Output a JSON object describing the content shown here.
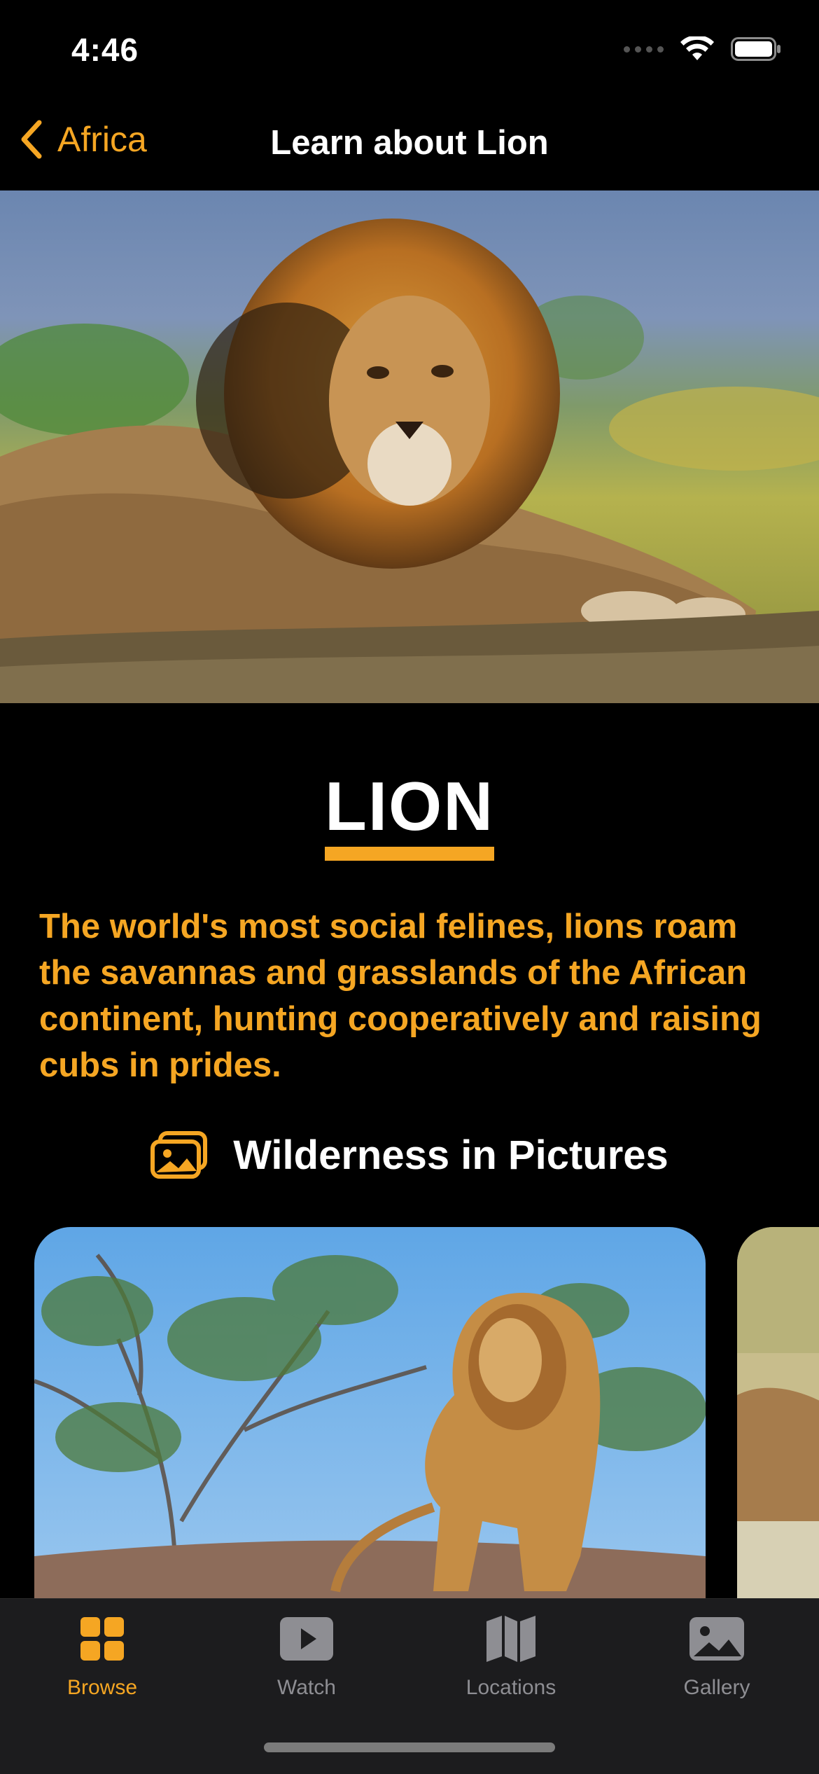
{
  "status_bar": {
    "time": "4:46"
  },
  "nav": {
    "back_label": "Africa",
    "title": "Learn about Lion"
  },
  "hero": {
    "image": "lion-lying-on-savanna"
  },
  "content": {
    "animal_name": "LION",
    "description": "The world's most social felines, lions roam the savannas and grasslands of the African continent, hunting cooperatively and raising cubs in prides.",
    "section_title": "Wilderness in Pictures",
    "section_icon": "photo-stack-icon"
  },
  "gallery": {
    "items": [
      {
        "image": "lion-walking-on-rock"
      },
      {
        "image": "lion-in-grass-partial"
      }
    ]
  },
  "tabbar": {
    "tabs": [
      {
        "label": "Browse",
        "icon": "grid-icon",
        "active": true
      },
      {
        "label": "Watch",
        "icon": "play-icon",
        "active": false
      },
      {
        "label": "Locations",
        "icon": "map-icon",
        "active": false
      },
      {
        "label": "Gallery",
        "icon": "photo-icon",
        "active": false
      }
    ]
  },
  "colors": {
    "accent": "#F5A623",
    "background": "#000000",
    "tabbar": "#1C1C1E",
    "inactive": "#8E8E93"
  }
}
